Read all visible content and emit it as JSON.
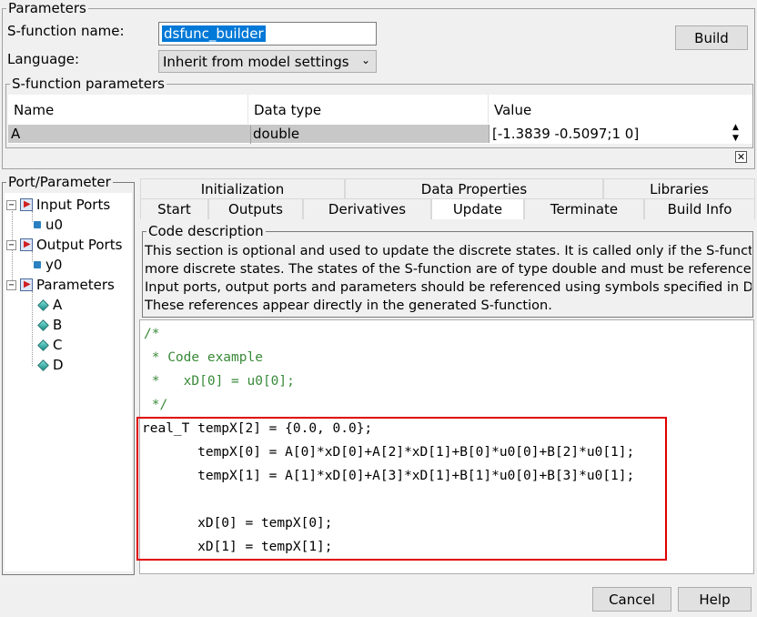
{
  "parameters": {
    "group_title": "Parameters",
    "sfunction_name_label": "S-function name:",
    "sfunction_name_value": "dsfunc_builder",
    "language_label": "Language:",
    "language_value": "Inherit from model settings",
    "build_label": "Build"
  },
  "sfunc_params": {
    "group_title": "S-function parameters",
    "columns": [
      "Name",
      "Data type",
      "Value"
    ],
    "rows": [
      {
        "name": "A",
        "data_type": "double",
        "value": "[-1.3839 -0.5097;1 0]"
      }
    ]
  },
  "port_parameter": {
    "group_title": "Port/Parameter",
    "input_ports": "Input Ports",
    "input_items": [
      "u0"
    ],
    "output_ports": "Output Ports",
    "output_items": [
      "y0"
    ],
    "parameters": "Parameters",
    "parameter_items": [
      "A",
      "B",
      "C",
      "D"
    ]
  },
  "tabs": {
    "top": [
      "Initialization",
      "Data Properties",
      "Libraries"
    ],
    "bottom": [
      "Start",
      "Outputs",
      "Derivatives",
      "Update",
      "Terminate",
      "Build Info"
    ],
    "active": "Update"
  },
  "code_description": {
    "title": "Code description",
    "lines": [
      "This section is optional and used to update the discrete states. It is called only if the S-functi",
      "more discrete states. The states of the S-function are of type double and must be reference",
      "Input ports, output ports and parameters should be referenced using symbols specified in D",
      "These references appear directly in the generated S-function."
    ]
  },
  "code": {
    "lines": [
      {
        "text": "/*",
        "comment": true
      },
      {
        "text": " * Code example",
        "comment": true
      },
      {
        "text": " *   xD[0] = u0[0];",
        "comment": true
      },
      {
        "text": " */",
        "comment": true
      },
      {
        "text": "real_T tempX[2] = {0.0, 0.0};",
        "comment": false
      },
      {
        "text": "       tempX[0] = A[0]*xD[0]+A[2]*xD[1]+B[0]*u0[0]+B[2]*u0[1];",
        "comment": false
      },
      {
        "text": "       tempX[1] = A[1]*xD[0]+A[3]*xD[1]+B[1]*u0[0]+B[3]*u0[1];",
        "comment": false
      },
      {
        "text": "",
        "comment": false
      },
      {
        "text": "       xD[0] = tempX[0];",
        "comment": false
      },
      {
        "text": "       xD[1] = tempX[1];",
        "comment": false
      }
    ],
    "highlight_color": "#e00000",
    "comment_color": "#3a8a3a"
  },
  "footer": {
    "cancel_label": "Cancel",
    "help_label": "Help"
  }
}
